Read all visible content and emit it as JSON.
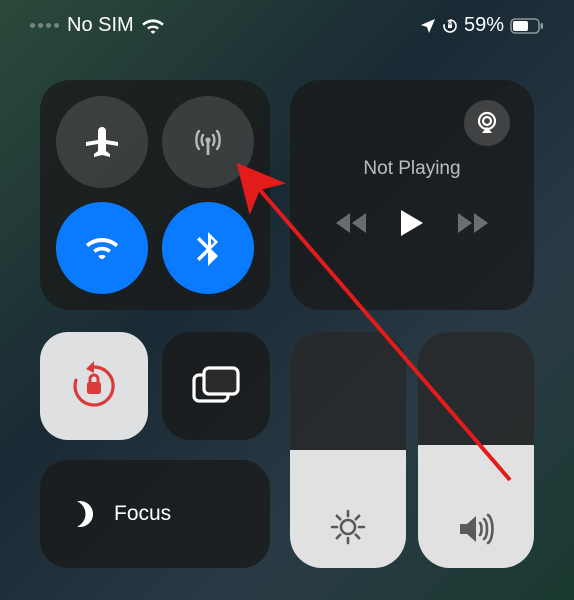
{
  "status_bar": {
    "carrier": "No SIM",
    "battery_pct": "59%"
  },
  "media": {
    "now_playing": "Not Playing"
  },
  "focus": {
    "label": "Focus"
  },
  "sliders": {
    "brightness_pct": 50,
    "volume_pct": 52
  },
  "colors": {
    "accent_blue": "#0a7aff",
    "lock_red": "#d93a3a"
  }
}
